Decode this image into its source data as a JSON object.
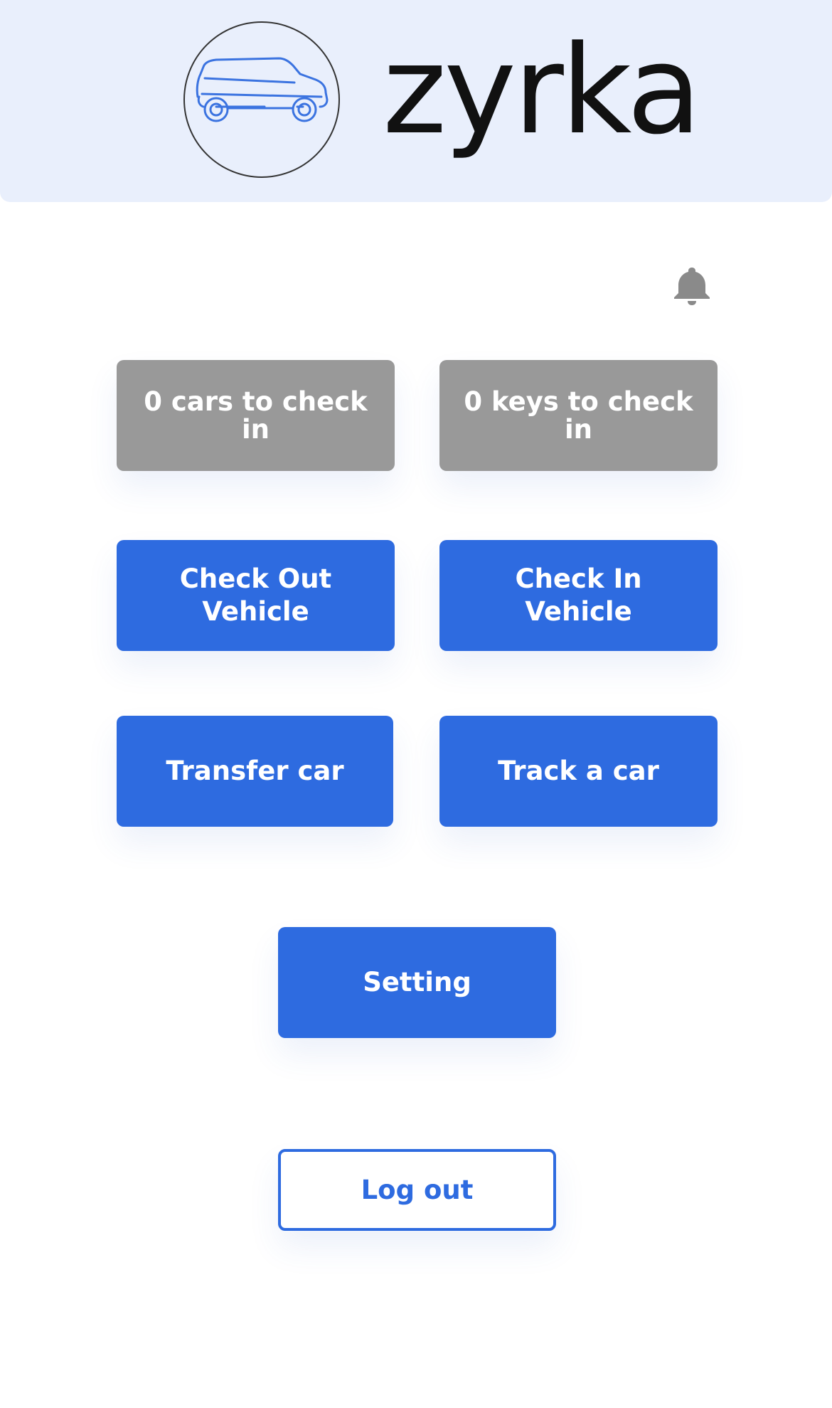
{
  "header": {
    "brand": "zyrka",
    "logo_icon": "car-outline-icon",
    "logo_color": "#3b73e0",
    "background": "#e9effc"
  },
  "notifications": {
    "icon": "bell-icon",
    "color": "#8a8a8a"
  },
  "stats": {
    "cars_to_check_in": "0 cars to check in",
    "keys_to_check_in": "0 keys to check in"
  },
  "actions": {
    "check_out_vehicle": "Check Out Vehicle",
    "check_in_vehicle": "Check In Vehicle",
    "transfer_car": "Transfer car",
    "track_a_car": "Track a car",
    "setting": "Setting",
    "log_out": "Log out"
  },
  "colors": {
    "primary": "#2e6be0",
    "stat_gray": "#999999",
    "background": "#ffffff"
  }
}
